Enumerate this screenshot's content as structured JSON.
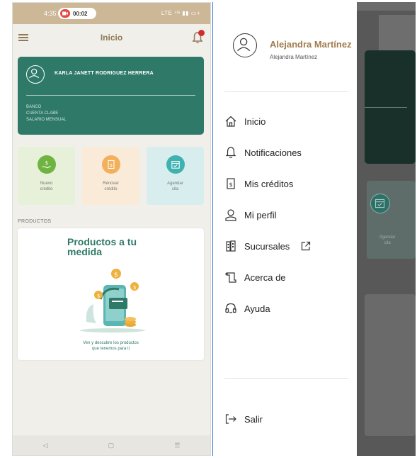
{
  "left": {
    "status": {
      "time": "4:35",
      "rec_time": "00:02",
      "right": "LTE ⁴ᴳ ▮▮ ▭+"
    },
    "header": {
      "title": "Inicio"
    },
    "account": {
      "name": "KARLA JANETT RODRIGUEZ HERRERA",
      "line1": "BANCO",
      "line2": "CUENTA CLABE",
      "line3": "SALARIO MENSUAL"
    },
    "quick_actions": [
      {
        "label": "Nuevo\ncrédito",
        "icon": "hand-money-icon",
        "color": "#6fb441"
      },
      {
        "label": "Renovar\ncrédito",
        "icon": "document-money-icon",
        "color": "#f3b05c"
      },
      {
        "label": "Agendar\ncita",
        "icon": "calendar-check-icon",
        "color": "#3fb1b1"
      }
    ],
    "products": {
      "section_label": "PRODUCTOS",
      "title": "Productos a tu medida",
      "caption": "Ven y descubre los productos\nque tenemos para ti"
    },
    "nav": {
      "back": "◁",
      "home": "▢",
      "menu": "☰"
    }
  },
  "right": {
    "profile": {
      "name": "Alejandra Martínez",
      "subtitle": "Alejandra Martínez"
    },
    "menu": [
      {
        "label": "Inicio",
        "icon": "home-icon"
      },
      {
        "label": "Notificaciones",
        "icon": "bell-icon"
      },
      {
        "label": "Mis créditos",
        "icon": "credit-document-icon"
      },
      {
        "label": "Mi perfil",
        "icon": "person-icon"
      },
      {
        "label": "Sucursales",
        "icon": "building-icon"
      },
      {
        "label": "Acerca de",
        "icon": "scroll-icon"
      },
      {
        "label": "Ayuda",
        "icon": "headset-icon"
      }
    ],
    "logout": {
      "label": "Salir",
      "icon": "logout-icon"
    },
    "background_tile": {
      "label": "Agendar\ncita"
    }
  },
  "colors": {
    "brand_green": "#2f7968",
    "brand_gold": "#a17b4c",
    "status_bar": "#ccb796",
    "notification_badge": "#d22d2d"
  }
}
